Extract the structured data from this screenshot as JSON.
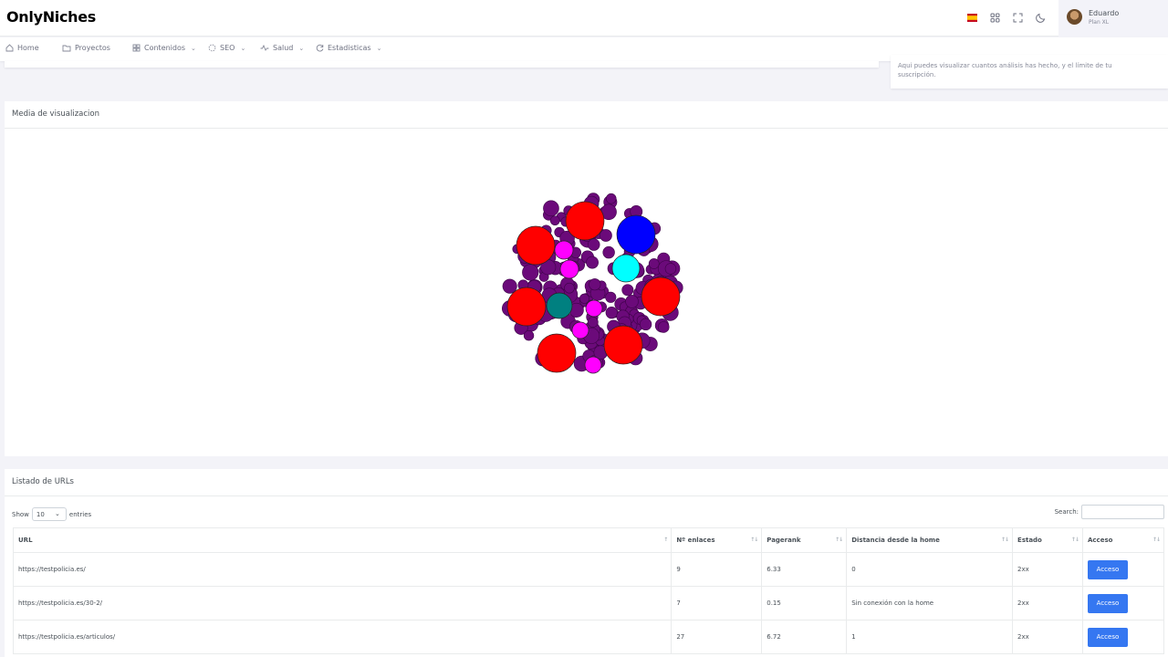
{
  "app": {
    "logo": "OnlyNiches"
  },
  "user": {
    "name": "Eduardo",
    "plan": "Plan XL"
  },
  "topbar_icons": [
    "spain-flag-icon",
    "apps-grid-icon",
    "fullscreen-icon",
    "moon-icon"
  ],
  "nav": {
    "items": [
      {
        "label": "Home",
        "icon": "home-icon",
        "dropdown": false
      },
      {
        "label": "Proyectos",
        "icon": "folder-icon",
        "dropdown": false
      },
      {
        "label": "Contenidos",
        "icon": "grid-icon",
        "dropdown": true
      },
      {
        "label": "SEO",
        "icon": "loader-icon",
        "dropdown": true
      },
      {
        "label": "Salud",
        "icon": "pulse-icon",
        "dropdown": true
      },
      {
        "label": "Estadisticas",
        "icon": "refresh-icon",
        "dropdown": true
      }
    ]
  },
  "info_card": {
    "text": "Aqui puedes visualizar cuantos análisis has hecho, y el límite de tu suscripción."
  },
  "visualization": {
    "title": "Media de visualizacion",
    "colors": {
      "small": "#6b0a7a",
      "red": "#ff0000",
      "blue": "#0000ff",
      "cyan": "#00ffff",
      "magenta": "#ff00ff",
      "teal": "#008080"
    }
  },
  "list": {
    "title": "Listado de URLs",
    "show_label": "Show",
    "entries_value": "10",
    "entries_label": "entries",
    "search_label": "Search:",
    "columns": [
      "URL",
      "Nº enlaces",
      "Pagerank",
      "Distancia desde la home",
      "Estado",
      "Acceso"
    ],
    "rows": [
      {
        "url": "https://testpolicia.es/",
        "enlaces": "9",
        "pagerank": "6.33",
        "distancia": "0",
        "estado": "2xx",
        "acceso": "Acceso"
      },
      {
        "url": "https://testpolicia.es/30-2/",
        "enlaces": "7",
        "pagerank": "0.15",
        "distancia": "Sin conexión con la home",
        "estado": "2xx",
        "acceso": "Acceso"
      },
      {
        "url": "https://testpolicia.es/articulos/",
        "enlaces": "27",
        "pagerank": "6.72",
        "distancia": "1",
        "estado": "2xx",
        "acceso": "Acceso"
      }
    ]
  }
}
